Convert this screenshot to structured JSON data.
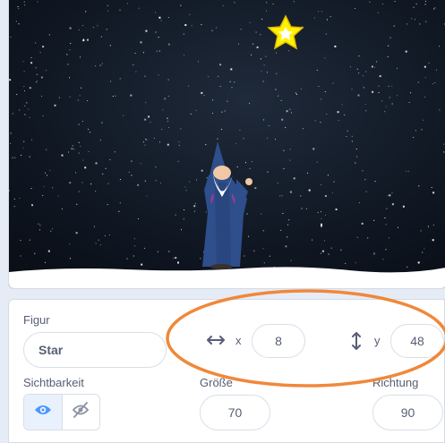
{
  "sprite_info": {
    "sprite_label": "Figur",
    "sprite_name": "Star",
    "x_label": "x",
    "x_value": "8",
    "y_label": "y",
    "y_value": "48",
    "visibility_label": "Sichtbarkeit",
    "size_label": "Größe",
    "size_value": "70",
    "direction_label": "Richtung",
    "direction_value": "90"
  },
  "colors": {
    "accent": "#4c97ff",
    "highlight": "#f0883a",
    "text": "#575e75",
    "sky": "#0e1420",
    "star": "#fff200"
  },
  "icons": [
    "horizontal-arrow-icon",
    "vertical-arrow-icon",
    "eye-icon",
    "eye-slash-icon"
  ]
}
